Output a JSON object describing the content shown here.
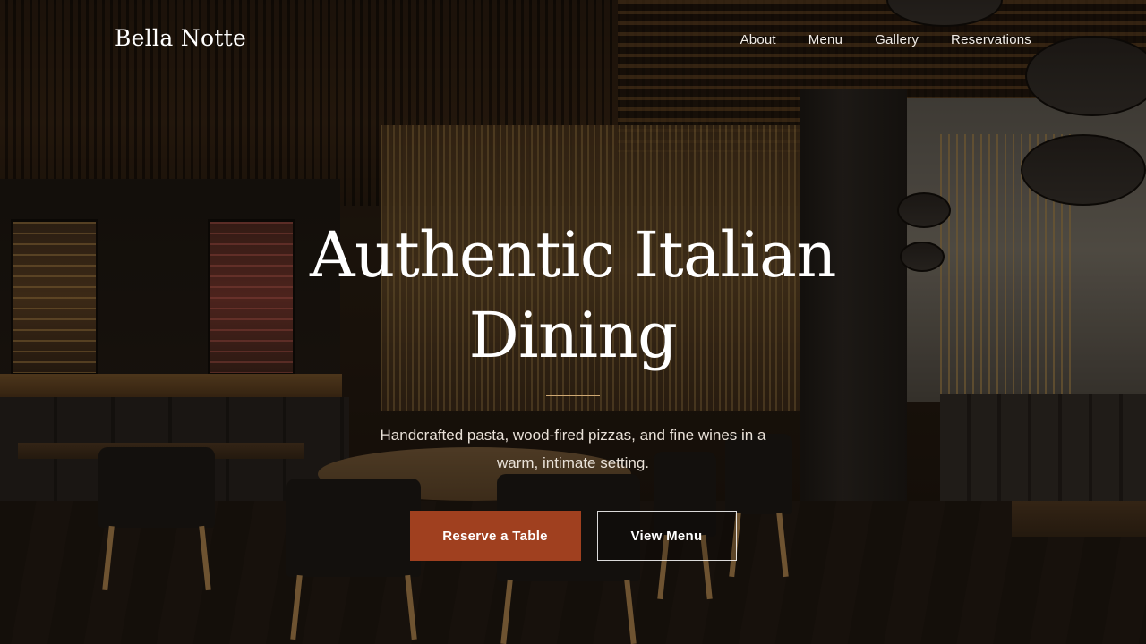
{
  "brand": {
    "name": "Bella Notte"
  },
  "nav": {
    "items": [
      {
        "label": "About"
      },
      {
        "label": "Menu"
      },
      {
        "label": "Gallery"
      },
      {
        "label": "Reservations"
      }
    ]
  },
  "hero": {
    "title_line1": "Authentic Italian",
    "title_line2": "Dining",
    "subtitle": "Handcrafted pasta, wood-fired pizzas, and fine wines in a warm, intimate setting.",
    "primary_cta": "Reserve a Table",
    "secondary_cta": "View Menu"
  },
  "colors": {
    "accent": "#a0401f",
    "divider": "#cfa873",
    "text": "#ffffff"
  },
  "background": {
    "description_icon": "restaurant-interior-image"
  }
}
